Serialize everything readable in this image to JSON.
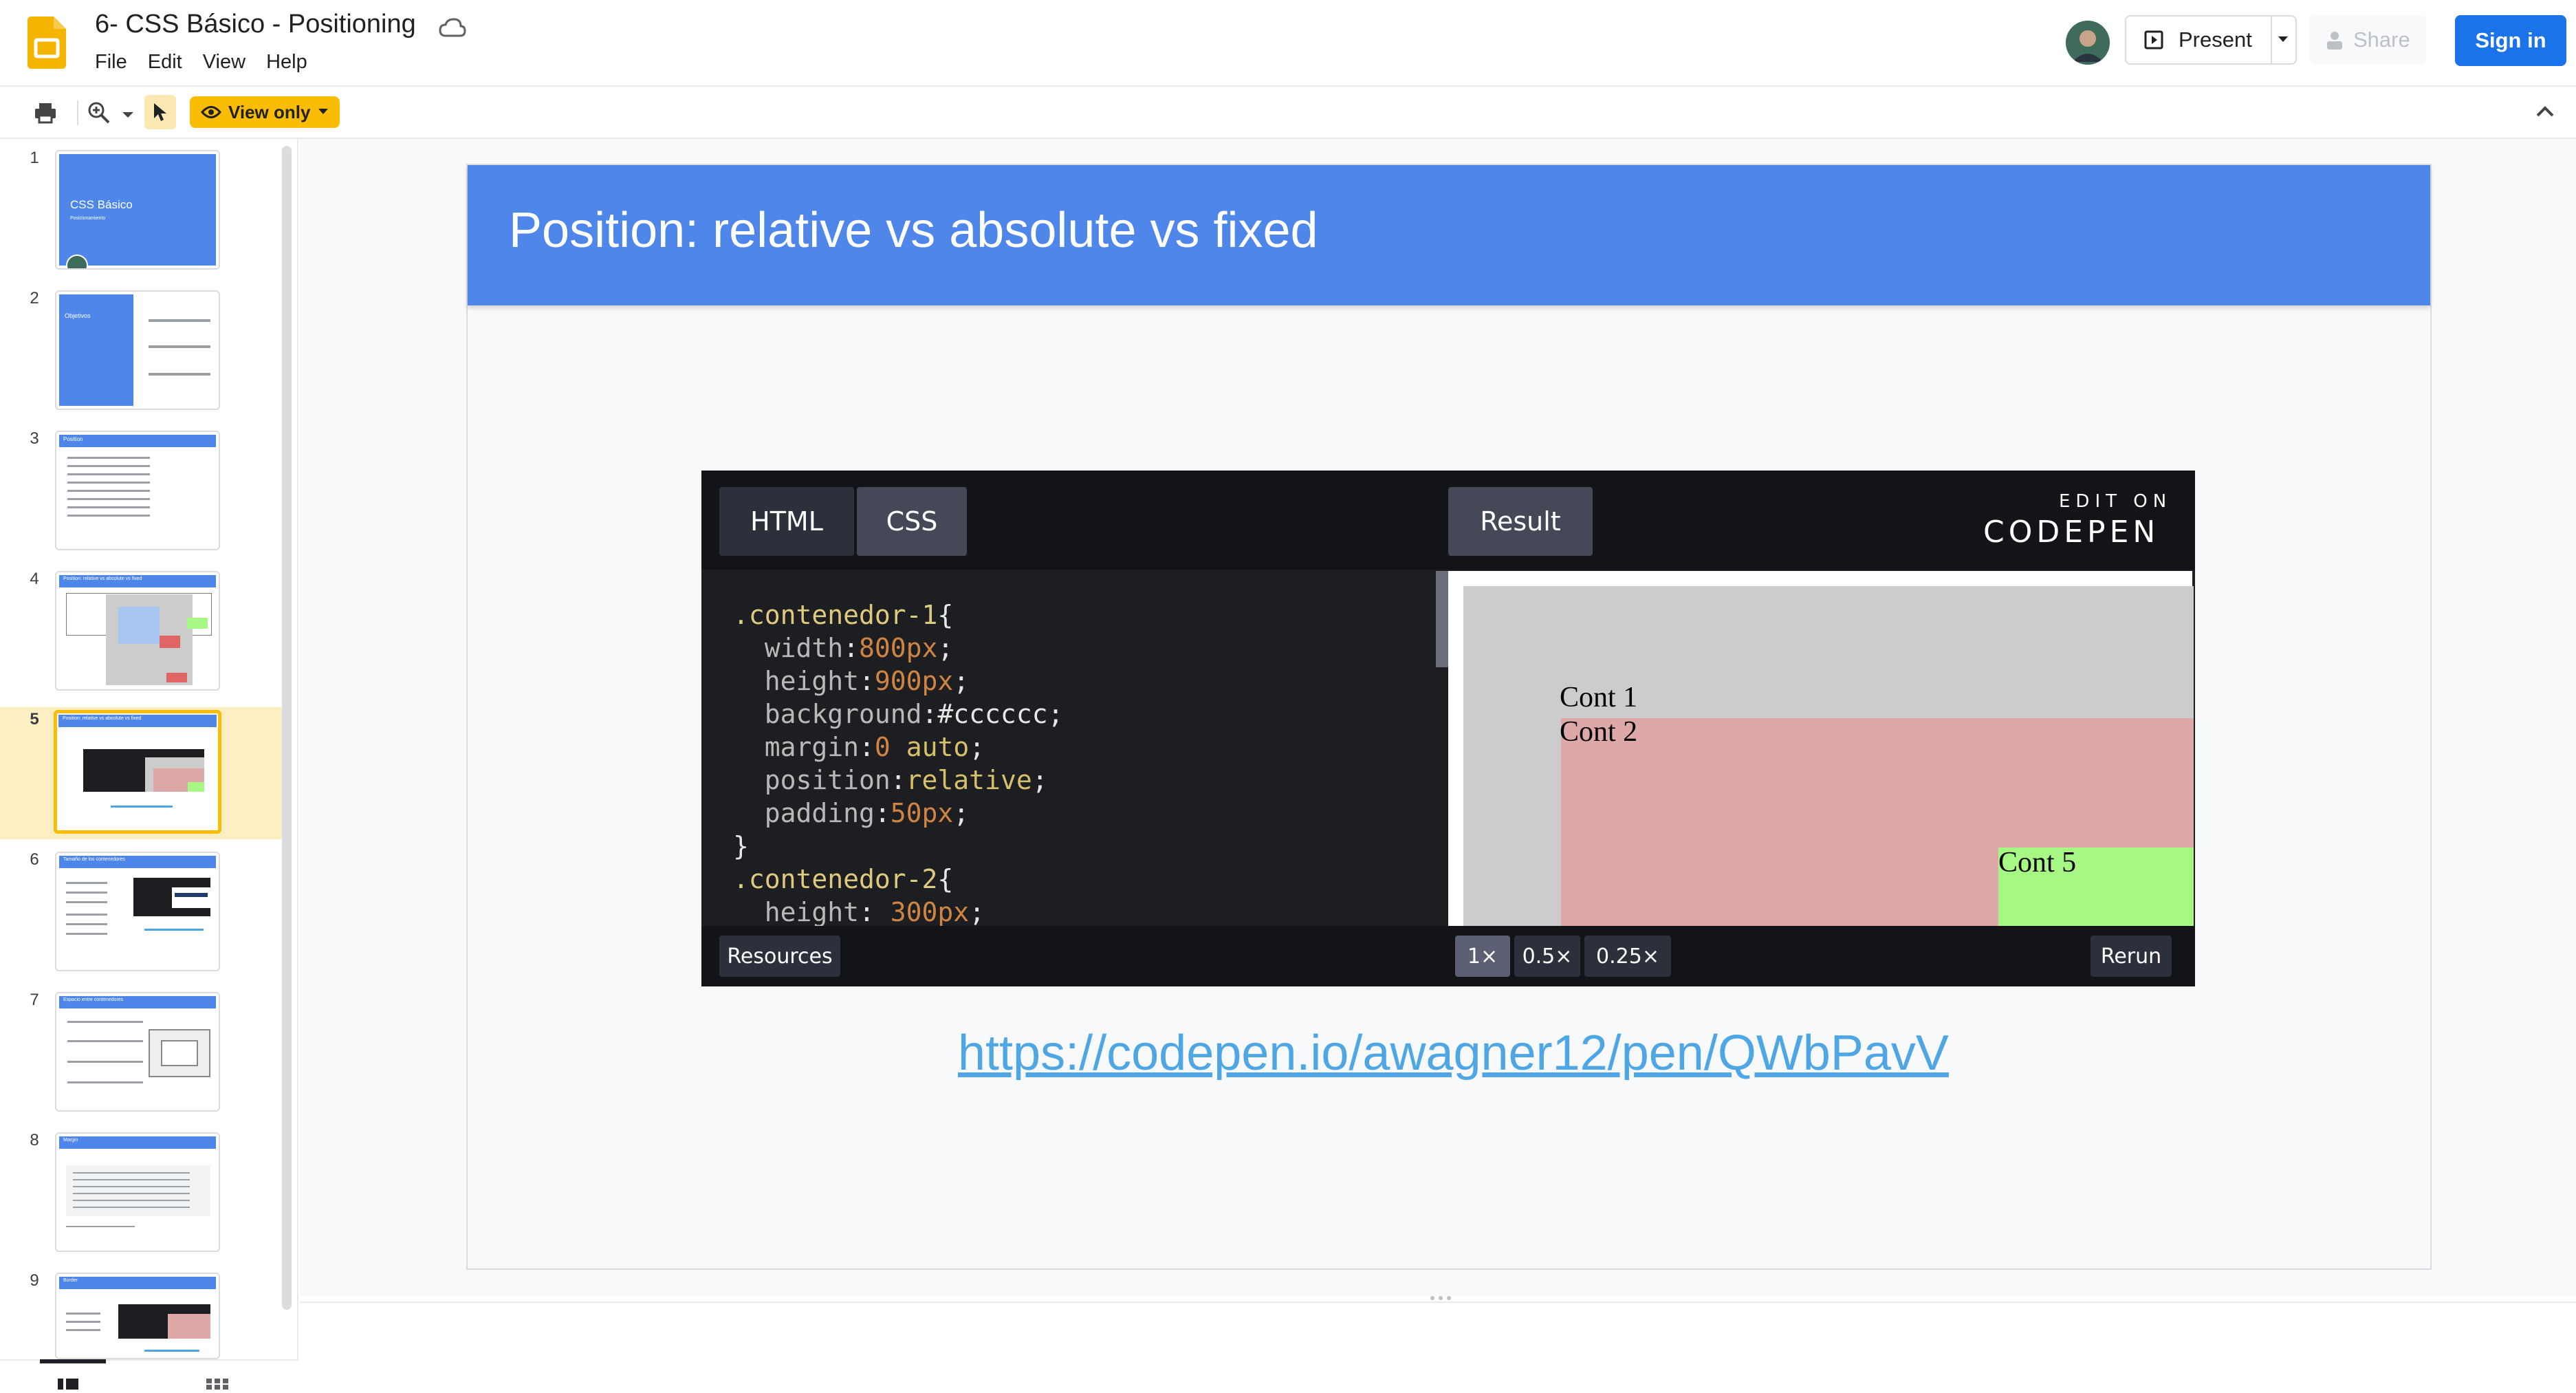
{
  "header": {
    "doc_title": "6- CSS Básico - Positioning",
    "menu": [
      "File",
      "Edit",
      "View",
      "Help"
    ],
    "present_label": "Present",
    "share_label": "Share",
    "signin_label": "Sign in"
  },
  "toolbar": {
    "view_only_label": "View only"
  },
  "filmstrip": {
    "selected_slide": 5,
    "slides": [
      {
        "number": "1",
        "title": "CSS Básico",
        "subtitle": "Posicionamiento"
      },
      {
        "number": "2",
        "title": "Objetivos"
      },
      {
        "number": "3",
        "title": "Position"
      },
      {
        "number": "4",
        "title": "Position: relative vs absolute vs fixed"
      },
      {
        "number": "5",
        "title": "Position: relative vs absolute vs fixed"
      },
      {
        "number": "6",
        "title": "Tamaño de los contenedores"
      },
      {
        "number": "7",
        "title": "Espacio entre contenedores"
      },
      {
        "number": "8",
        "title": "Margin"
      },
      {
        "number": "9",
        "title": "Border"
      }
    ]
  },
  "slide": {
    "title": "Position: relative vs absolute vs fixed",
    "link": "https://codepen.io/awagner12/pen/QWbPavV"
  },
  "codepen": {
    "tab_html": "HTML",
    "tab_css": "CSS",
    "tab_result": "Result",
    "edit_on": "EDIT ON",
    "codepen_brand": "CODEPEN",
    "code_lines": [
      [
        {
          "c": "sel",
          "t": ".contenedor-1"
        },
        {
          "c": "val",
          "t": "{"
        }
      ],
      [
        {
          "c": "prop",
          "t": "  width"
        },
        {
          "c": "val",
          "t": ":"
        },
        {
          "c": "num",
          "t": "800px"
        },
        {
          "c": "val",
          "t": ";"
        }
      ],
      [
        {
          "c": "prop",
          "t": "  height"
        },
        {
          "c": "val",
          "t": ":"
        },
        {
          "c": "num",
          "t": "900px"
        },
        {
          "c": "val",
          "t": ";"
        }
      ],
      [
        {
          "c": "prop",
          "t": "  background"
        },
        {
          "c": "val",
          "t": ":#cccccc;"
        }
      ],
      [
        {
          "c": "prop",
          "t": "  margin"
        },
        {
          "c": "val",
          "t": ":"
        },
        {
          "c": "num",
          "t": "0"
        },
        {
          "c": "kw",
          "t": " auto"
        },
        {
          "c": "val",
          "t": ";"
        }
      ],
      [
        {
          "c": "prop",
          "t": "  position"
        },
        {
          "c": "val",
          "t": ":"
        },
        {
          "c": "kw",
          "t": "relative"
        },
        {
          "c": "val",
          "t": ";"
        }
      ],
      [
        {
          "c": "prop",
          "t": "  padding"
        },
        {
          "c": "val",
          "t": ":"
        },
        {
          "c": "num",
          "t": "50px"
        },
        {
          "c": "val",
          "t": ";"
        }
      ],
      [
        {
          "c": "val",
          "t": "}"
        }
      ],
      [
        {
          "c": "sel",
          "t": ".contenedor-2"
        },
        {
          "c": "val",
          "t": "{"
        }
      ],
      [
        {
          "c": "prop",
          "t": "  height"
        },
        {
          "c": "val",
          "t": ": "
        },
        {
          "c": "num",
          "t": "300px"
        },
        {
          "c": "val",
          "t": ";"
        }
      ]
    ],
    "result_labels": {
      "cont1": "Cont 1",
      "cont2": "Cont 2",
      "cont5": "Cont 5"
    },
    "resources_label": "Resources",
    "zoom_options": [
      "1×",
      "0.5×",
      "0.25×"
    ],
    "rerun_label": "Rerun",
    "colors": {
      "cont1": "#cccccc",
      "cont2": "#dfa8a8",
      "cont5": "#a6f783"
    }
  },
  "colors": {
    "accent_blue": "#1a73e8",
    "slide_header": "#4f86ea",
    "view_only_bg": "#fbbc04",
    "link": "#4ea6e5"
  }
}
